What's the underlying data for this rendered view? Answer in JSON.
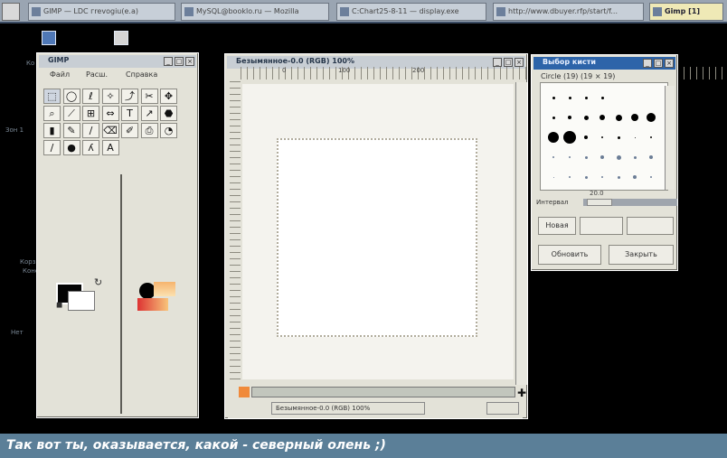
{
  "taskbar": {
    "buttons": [
      {
        "label": "GIMP — LDC гrevogiu(e.a)"
      },
      {
        "label": "MySQL@booklo.ru — Mozilla"
      },
      {
        "label": "C:Chart25-8-11 — display.exe"
      },
      {
        "label": "http://www.dbuyer.rfp/start/f..."
      },
      {
        "label": "Gimp [1]"
      }
    ]
  },
  "desktop": {
    "labels": [
      "Ко",
      "Зон 1",
      "Корз",
      "Коне сбод",
      "Нет"
    ]
  },
  "toolbox": {
    "title": "GIMP",
    "menu": [
      "Файл",
      "Расш.",
      "Справка"
    ],
    "tools": [
      {
        "glyph": "⬚",
        "name": "rect-select"
      },
      {
        "glyph": "◯",
        "name": "ellipse-select"
      },
      {
        "glyph": "ℓ",
        "name": "free-select"
      },
      {
        "glyph": "✧",
        "name": "fuzzy-select"
      },
      {
        "glyph": "⤴",
        "name": "bezier-select"
      },
      {
        "glyph": "✂",
        "name": "scissors"
      },
      {
        "glyph": "✥",
        "name": "move"
      },
      {
        "glyph": "⌕",
        "name": "magnify"
      },
      {
        "glyph": "⟋",
        "name": "crop"
      },
      {
        "glyph": "⊞",
        "name": "transform"
      },
      {
        "glyph": "⇔",
        "name": "flip"
      },
      {
        "glyph": "T",
        "name": "text"
      },
      {
        "glyph": "↗",
        "name": "color-picker"
      },
      {
        "glyph": "⬣",
        "name": "bucket-fill"
      },
      {
        "glyph": "▮",
        "name": "blend"
      },
      {
        "glyph": "✎",
        "name": "pencil"
      },
      {
        "glyph": "∕",
        "name": "paintbrush"
      },
      {
        "glyph": "⌫",
        "name": "eraser"
      },
      {
        "glyph": "✐",
        "name": "airbrush"
      },
      {
        "glyph": "⎙",
        "name": "clone"
      },
      {
        "glyph": "◔",
        "name": "convolve"
      },
      {
        "glyph": "∕",
        "name": "ink"
      },
      {
        "glyph": "●",
        "name": "dodge-burn"
      },
      {
        "glyph": "ʎ",
        "name": "smudge"
      },
      {
        "glyph": "A",
        "name": "measure"
      }
    ]
  },
  "canvas_window": {
    "title": "Безымянное-0.0 (RGB) 100%",
    "ruler_labels": [
      "0",
      "100",
      "200"
    ],
    "status_text": "Безымянное-0.0 (RGB) 100%"
  },
  "brush_window": {
    "title": "Выбор кисти",
    "brush_name": "Circle (19)  (19 × 19)",
    "value": "20.0",
    "spacing_label": "Интервал",
    "buttons": {
      "edit": "Новая",
      "refresh": "Обновить",
      "close": "Закрыть"
    }
  },
  "caption": "Так вот ты, оказывается, какой - северный олень ;)"
}
